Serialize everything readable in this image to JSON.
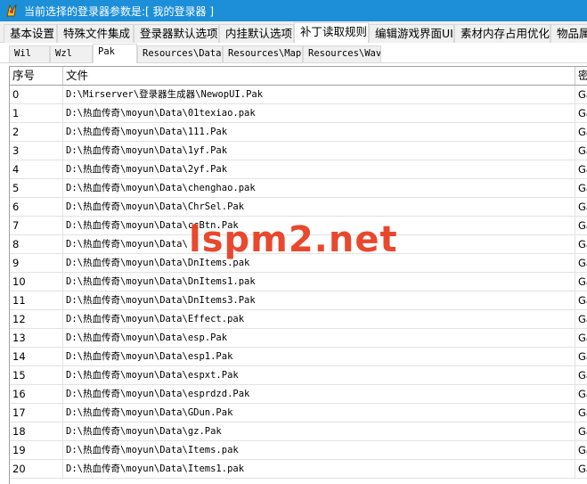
{
  "window": {
    "title": "当前选择的登录器参数是:[ 我的登录器 ]"
  },
  "main_tabs": [
    {
      "label": "基本设置"
    },
    {
      "label": "特殊文件集成"
    },
    {
      "label": "登录器默认选项"
    },
    {
      "label": "内挂默认选项"
    },
    {
      "label": "补丁读取规则"
    },
    {
      "label": "编辑游戏界面UI"
    },
    {
      "label": "素材内存占用优化"
    },
    {
      "label": "物品属"
    }
  ],
  "sub_tabs": [
    {
      "label": "Wil"
    },
    {
      "label": "Wzl"
    },
    {
      "label": "Pak"
    },
    {
      "label": "Resources\\Data"
    },
    {
      "label": "Resources\\Map"
    },
    {
      "label": "Resources\\Wav"
    }
  ],
  "table": {
    "columns": [
      "序号",
      "文件",
      "密"
    ],
    "rows": [
      {
        "idx": "0",
        "file": "D:\\Mirserver\\登录器生成器\\NewopUI.Pak",
        "pw": "Ga"
      },
      {
        "idx": "1",
        "file": "D:\\热血传奇\\moyun\\Data\\01texiao.pak",
        "pw": "Ga"
      },
      {
        "idx": "2",
        "file": "D:\\热血传奇\\moyun\\Data\\111.Pak",
        "pw": "Ga"
      },
      {
        "idx": "3",
        "file": "D:\\热血传奇\\moyun\\Data\\1yf.Pak",
        "pw": "Ga"
      },
      {
        "idx": "4",
        "file": "D:\\热血传奇\\moyun\\Data\\2yf.Pak",
        "pw": "Ga"
      },
      {
        "idx": "5",
        "file": "D:\\热血传奇\\moyun\\Data\\chenghao.pak",
        "pw": "Ga"
      },
      {
        "idx": "6",
        "file": "D:\\热血传奇\\moyun\\Data\\ChrSel.Pak",
        "pw": "Ga"
      },
      {
        "idx": "7",
        "file": "D:\\热血传奇\\moyun\\Data\\ccBtn.Pak",
        "pw": "Ga"
      },
      {
        "idx": "8",
        "file": "D:\\热血传奇\\moyun\\Data\\",
        "pw": "Ga"
      },
      {
        "idx": "9",
        "file": "D:\\热血传奇\\moyun\\Data\\DnItems.pak",
        "pw": "Ga"
      },
      {
        "idx": "10",
        "file": "D:\\热血传奇\\moyun\\Data\\DnItems1.pak",
        "pw": "Ga"
      },
      {
        "idx": "11",
        "file": "D:\\热血传奇\\moyun\\Data\\DnItems3.Pak",
        "pw": "Ga"
      },
      {
        "idx": "12",
        "file": "D:\\热血传奇\\moyun\\Data\\Effect.pak",
        "pw": "Ga"
      },
      {
        "idx": "13",
        "file": "D:\\热血传奇\\moyun\\Data\\esp.Pak",
        "pw": "Ga"
      },
      {
        "idx": "14",
        "file": "D:\\热血传奇\\moyun\\Data\\esp1.Pak",
        "pw": "Ga"
      },
      {
        "idx": "15",
        "file": "D:\\热血传奇\\moyun\\Data\\espxt.Pak",
        "pw": "Ga"
      },
      {
        "idx": "16",
        "file": "D:\\热血传奇\\moyun\\Data\\esprdzd.Pak",
        "pw": "Ga"
      },
      {
        "idx": "17",
        "file": "D:\\热血传奇\\moyun\\Data\\GDun.Pak",
        "pw": "Ga"
      },
      {
        "idx": "18",
        "file": "D:\\热血传奇\\moyun\\Data\\gz.Pak",
        "pw": "Ga"
      },
      {
        "idx": "19",
        "file": "D:\\热血传奇\\moyun\\Data\\Items.pak",
        "pw": "Ga"
      },
      {
        "idx": "20",
        "file": "D:\\热血传奇\\moyun\\Data\\Items1.pak",
        "pw": "Ga"
      }
    ]
  },
  "watermark": "lspm2.net",
  "colors": {
    "titlebar": "#1c8fd8",
    "watermark": "#e8391d"
  },
  "icons": {
    "app": "app-icon"
  }
}
